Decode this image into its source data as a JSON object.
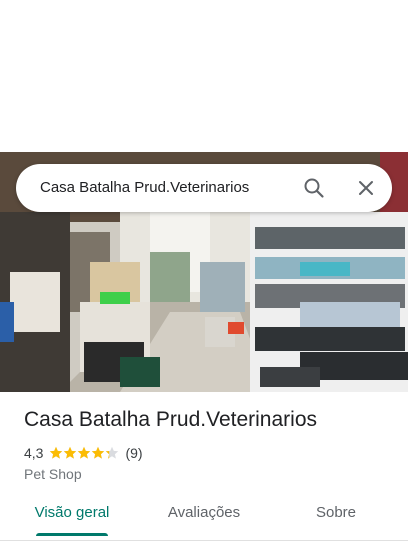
{
  "search": {
    "query": "Casa Batalha Prud.Veterinarios",
    "search_icon": "search-icon",
    "close_icon": "close-icon"
  },
  "photo": {
    "subject": "store-interior-photo"
  },
  "place": {
    "name": "Casa Batalha Prud.Veterinarios",
    "rating": "4,3",
    "rating_value": 4.3,
    "rating_max": 5,
    "review_count": "(9)",
    "category": "Pet Shop"
  },
  "tabs": [
    {
      "label": "Visão geral",
      "active": true
    },
    {
      "label": "Avaliações",
      "active": false
    },
    {
      "label": "Sobre",
      "active": false
    }
  ],
  "colors": {
    "accent": "#00796b",
    "star": "#fbbc04",
    "star_empty": "#dadce0"
  }
}
